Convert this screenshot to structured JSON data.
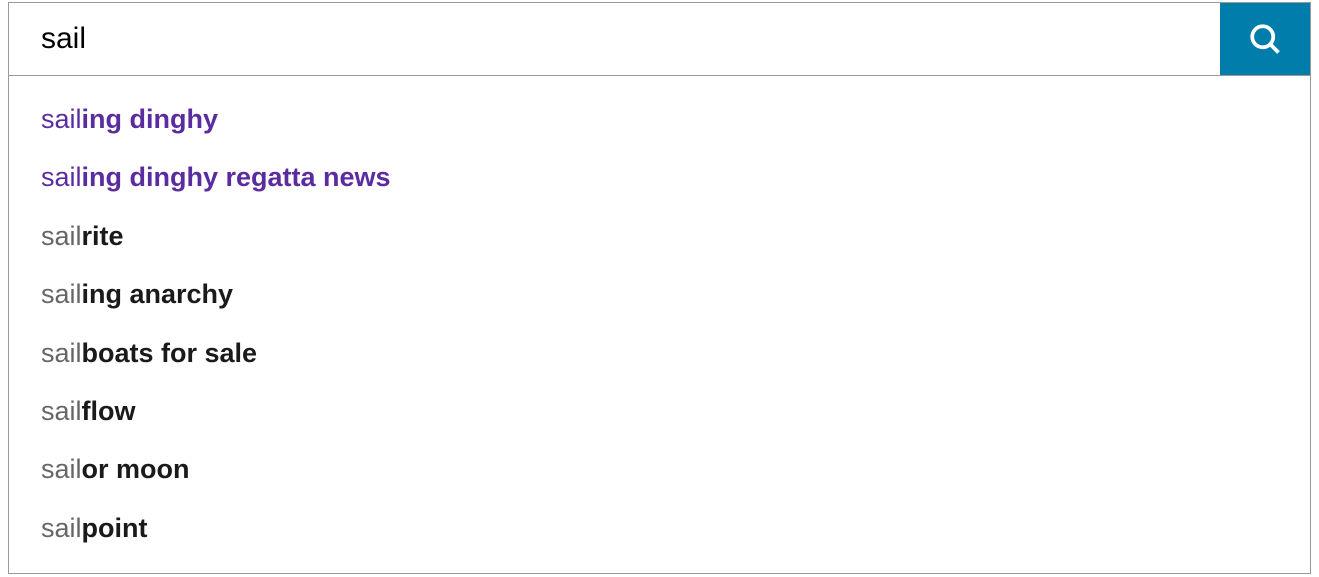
{
  "search": {
    "value": "sail",
    "button_icon": "search-icon",
    "button_color": "#007daa"
  },
  "suggestions": [
    {
      "prefix": "sail",
      "completion": "ing dinghy",
      "visited": true
    },
    {
      "prefix": "sail",
      "completion": "ing dinghy regatta news",
      "visited": true
    },
    {
      "prefix": "sail",
      "completion": "rite",
      "visited": false
    },
    {
      "prefix": "sail",
      "completion": "ing anarchy",
      "visited": false
    },
    {
      "prefix": "sail",
      "completion": "boats for sale",
      "visited": false
    },
    {
      "prefix": "sail",
      "completion": "flow",
      "visited": false
    },
    {
      "prefix": "sail",
      "completion": "or moon",
      "visited": false
    },
    {
      "prefix": "sail",
      "completion": "point",
      "visited": false
    }
  ]
}
